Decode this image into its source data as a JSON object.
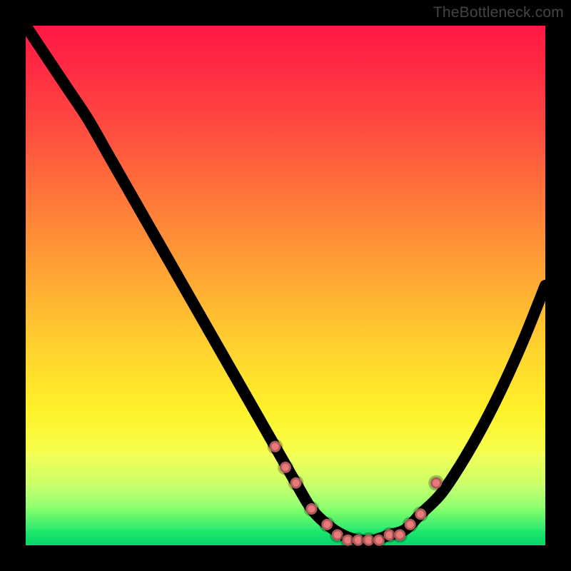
{
  "watermark": "TheBottleneck.com",
  "chart_data": {
    "type": "line",
    "title": "",
    "xlabel": "",
    "ylabel": "",
    "xlim": [
      0,
      100
    ],
    "ylim": [
      0,
      100
    ],
    "grid": false,
    "legend": false,
    "background": {
      "gradient_direction": "vertical",
      "stops": [
        {
          "pos": 0,
          "color": "#ff1844"
        },
        {
          "pos": 20,
          "color": "#ff4d40"
        },
        {
          "pos": 48,
          "color": "#ffa534"
        },
        {
          "pos": 74,
          "color": "#fff12a"
        },
        {
          "pos": 88,
          "color": "#c8ff58"
        },
        {
          "pos": 100,
          "color": "#03d66b"
        }
      ]
    },
    "series": [
      {
        "name": "bottleneck-curve",
        "color": "#000000",
        "x": [
          0,
          4,
          8,
          12,
          16,
          20,
          24,
          28,
          32,
          36,
          40,
          44,
          48,
          52,
          55,
          58,
          61,
          64,
          67,
          70,
          73,
          76,
          80,
          84,
          88,
          92,
          96,
          100
        ],
        "y": [
          100,
          94,
          88,
          82,
          75,
          68,
          61,
          54,
          47,
          40,
          33,
          26,
          19,
          12,
          7,
          4,
          2,
          1,
          1,
          2,
          3,
          6,
          10,
          16,
          23,
          31,
          40,
          50
        ]
      }
    ],
    "markers": {
      "name": "highlight-dots",
      "color": "#e97a7a",
      "x": [
        48,
        50,
        52,
        55,
        58,
        60,
        62,
        64,
        66,
        68,
        70,
        72,
        74,
        76,
        79
      ],
      "y": [
        19,
        15,
        12,
        7,
        4,
        2,
        1,
        1,
        1,
        1,
        2,
        2,
        4,
        6,
        12
      ]
    }
  }
}
